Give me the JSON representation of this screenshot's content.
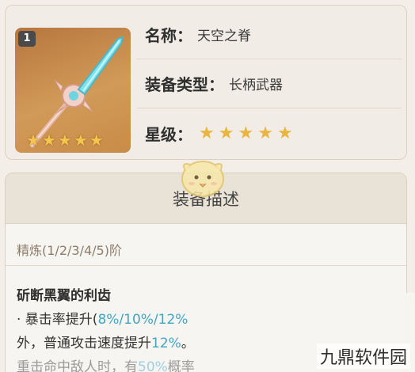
{
  "weapon": {
    "refine_badge": "1",
    "thumb_stars": 5,
    "name_label": "名称：",
    "name_value": "天空之脊",
    "type_label": "装备类型：",
    "type_value": "长柄武器",
    "rarity_label": "星级：",
    "rarity_stars": 5
  },
  "description": {
    "header": "装备描述",
    "refine_line": "精炼(1/2/3/4/5)阶",
    "passive_title": "斫断黑翼的利齿",
    "line1_prefix": "· 暴击率提升(",
    "line1_values": "8%/10%/12%",
    "line2_prefix": "外，普通攻击速度提升",
    "line2_value": "12%",
    "line2_suffix": "。",
    "line3_prefix": "重击命中敌人时，有",
    "line3_value": "50%",
    "line3_suffix": "概率"
  },
  "watermark": "九鼎软件园",
  "colors": {
    "highlight": "#3ea6c5",
    "star": "#e9b53f",
    "header_bg": "#e9e2d7"
  }
}
